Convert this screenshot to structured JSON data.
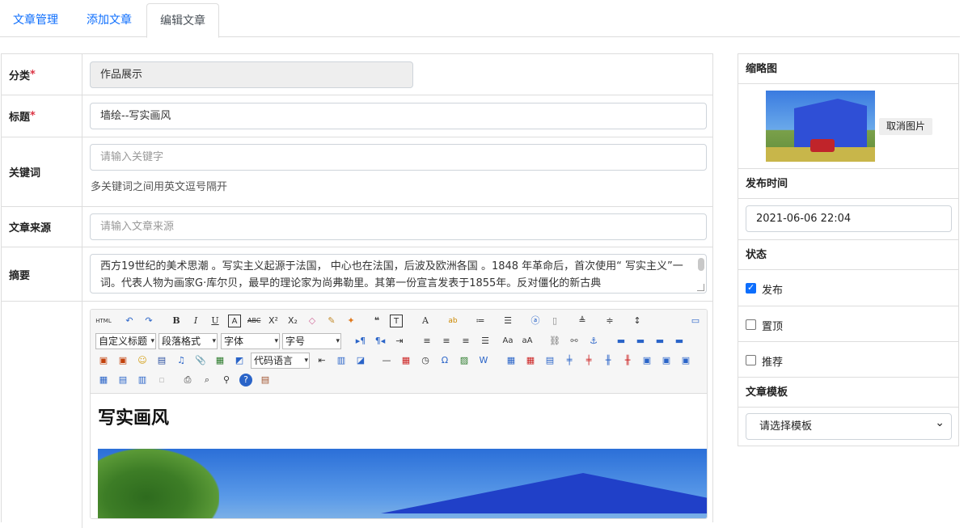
{
  "tabs": [
    {
      "label": "文章管理"
    },
    {
      "label": "添加文章"
    },
    {
      "label": "编辑文章"
    }
  ],
  "form": {
    "category_label": "分类",
    "category_value": "作品展示",
    "title_label": "标题",
    "title_value": "墙绘--写实画风",
    "keywords_label": "关键词",
    "keywords_placeholder": "请输入关键字",
    "keywords_hint": "多关键词之间用英文逗号隔开",
    "source_label": "文章来源",
    "source_placeholder": "请输入文章来源",
    "summary_label": "摘要",
    "summary_value": "西方19世纪的美术思潮 。写实主义起源于法国， 中心也在法国，后波及欧洲各国 。1848 年革命后，首次使用“ 写实主义”一词。代表人物为画家G·库尔贝，最早的理论家为尚弗勒里。其第一份宣言发表于1855年。反对僵化的新古典",
    "required_mark": "*"
  },
  "editor": {
    "content_heading": "写实画风",
    "dropdowns": [
      "自定义标题",
      "段落格式",
      "字体",
      "字号",
      "代码语言"
    ],
    "html_button": "HTML"
  },
  "sidebar": {
    "thumbnail_label": "缩略图",
    "cancel_image_label": "取消图片",
    "publish_time_label": "发布时间",
    "publish_time_value": "2021-06-06 22:04",
    "status_label": "状态",
    "publish_label": "发布",
    "publish_checked": true,
    "pin_label": "置顶",
    "pin_checked": false,
    "recommend_label": "推荐",
    "recommend_checked": false,
    "template_label": "文章模板",
    "template_selected": "请选择模板"
  },
  "colors": {
    "link": "#0d6efd",
    "required": "#dc3545",
    "checkbox_on": "#0d6efd"
  }
}
